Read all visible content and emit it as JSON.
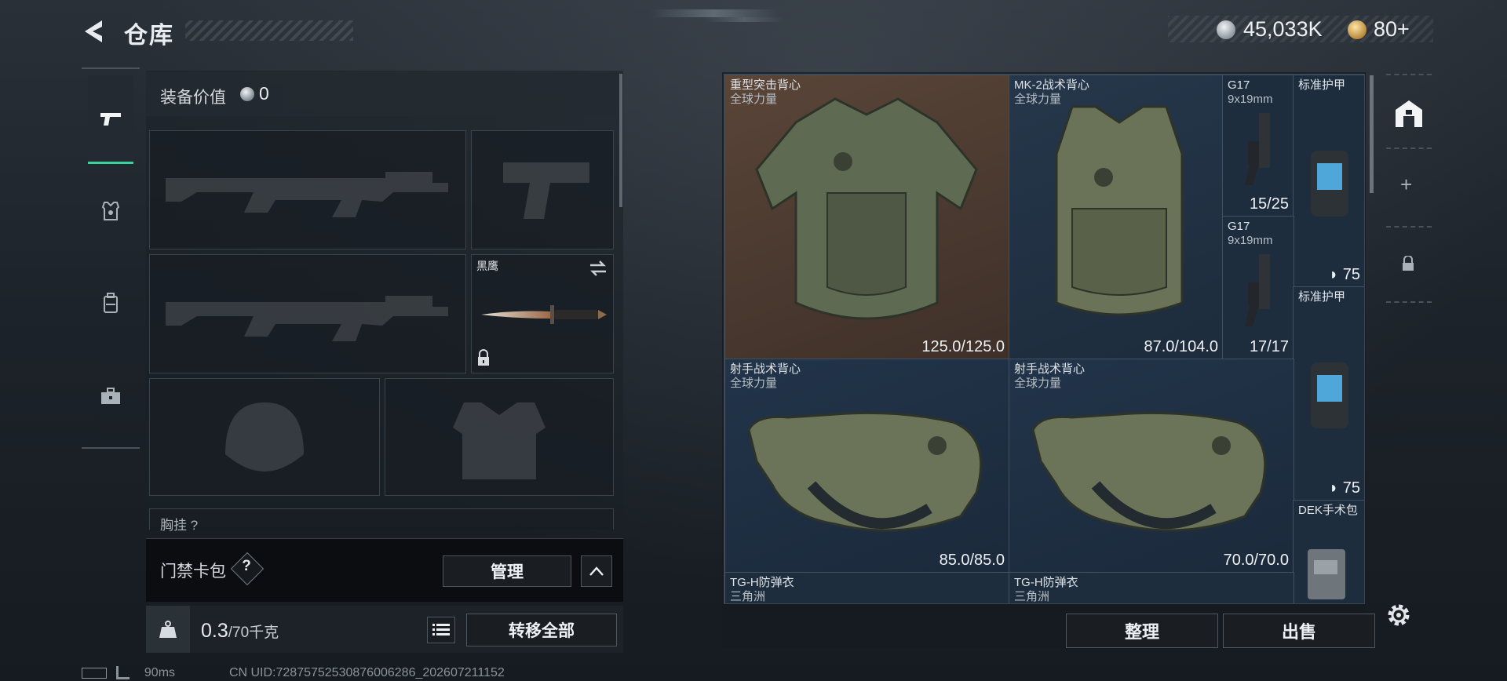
{
  "header": {
    "title": "仓库",
    "currency": {
      "money": "45,033K",
      "gold": "80+"
    }
  },
  "nav": {
    "items": [
      {
        "name": "weapons",
        "icon": "pistol-icon",
        "active": true
      },
      {
        "name": "armor",
        "icon": "armor-vest-icon",
        "active": false
      },
      {
        "name": "backpack",
        "icon": "backpack-icon",
        "active": false
      },
      {
        "name": "supplies",
        "icon": "toolbox-icon",
        "active": false
      }
    ]
  },
  "loadout": {
    "equip_value_label": "装备价值",
    "equip_value": "0",
    "melee_name": "黑鹰",
    "chest_label": "胸挂 ?",
    "keycard_label": "门禁卡包",
    "help_glyph": "?",
    "manage_label": "管理",
    "weight_current": "0.3",
    "weight_max": "/70千克",
    "transfer_all_label": "转移全部"
  },
  "stash": {
    "items": [
      {
        "name": "重型突击背心",
        "sub": "全球力量",
        "durability": "125.0/125.0"
      },
      {
        "name": "MK-2战术背心",
        "sub": "全球力量",
        "durability": "87.0/104.0"
      },
      {
        "name": "G17",
        "sub": "9x19mm",
        "ammo": "15/25"
      },
      {
        "name": "标准护甲",
        "armor": "75"
      },
      {
        "name": "G17",
        "sub": "9x19mm",
        "ammo": "17/17"
      },
      {
        "name": "标准护甲",
        "armor": "75"
      },
      {
        "name": "射手战术背心",
        "sub": "全球力量",
        "durability": "85.0/85.0"
      },
      {
        "name": "射手战术背心",
        "sub": "全球力量",
        "durability": "70.0/70.0"
      },
      {
        "name": "DEK手术包"
      },
      {
        "name": "TG-H防弹衣",
        "sub": "三角洲"
      },
      {
        "name": "TG-H防弹衣",
        "sub": "三角洲"
      }
    ],
    "organize_label": "整理",
    "sell_label": "出售"
  },
  "status": {
    "ping": "90ms",
    "uid": "CN UID:7287575253087600628​6_202607211152"
  },
  "colors": {
    "accent_green": "#37d39a",
    "orange_cell": "#4a3a30",
    "blue_cell": "#1d3147",
    "panel_bg": "#1a2026"
  }
}
